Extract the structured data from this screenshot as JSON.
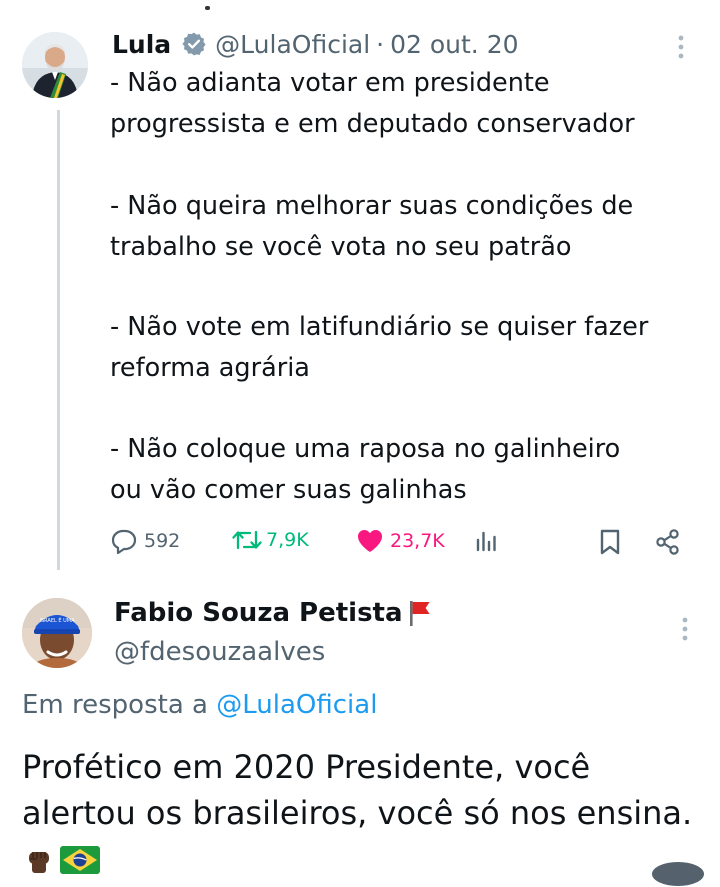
{
  "tweet": {
    "author_name": "Lula",
    "handle": "@LulaOficial",
    "separator": "·",
    "date": "02 out. 20",
    "paragraphs": [
      [
        "- Não adianta votar em presidente",
        "progressista e em deputado conservador"
      ],
      [
        "- Não queira melhorar suas condições de",
        "trabalho se você vota no seu patrão"
      ],
      [
        "- Não vote em latifundiário se quiser fazer",
        "reforma agrária"
      ],
      [
        "- Não coloque uma raposa no galinheiro",
        "ou vão comer suas galinhas"
      ]
    ],
    "replies": "592",
    "retweets": "7,9K",
    "likes": "23,7K",
    "colors": {
      "retweet": "#00ba7c",
      "like": "#f91880",
      "verified": "#829aab"
    }
  },
  "reply": {
    "author_name": "Fabio Souza Petista",
    "handle": "@fdesouzaalves",
    "in_reply_prefix": "Em resposta a",
    "in_reply_handle": "@LulaOficial",
    "body": "Profético em 2020 Presidente,  você alertou os brasileiros,  você só nos ensina.",
    "avatar_cap_text": "ISRAEL É UMA ABERRAÇÃO",
    "link_color": "#1d9bf0"
  },
  "icons": [
    "verified-badge-icon",
    "more-options-icon",
    "reply-icon",
    "retweet-icon",
    "like-icon",
    "views-icon",
    "bookmark-icon",
    "share-icon",
    "red-flag-icon",
    "raised-fist-icon",
    "brazil-flag-icon"
  ]
}
